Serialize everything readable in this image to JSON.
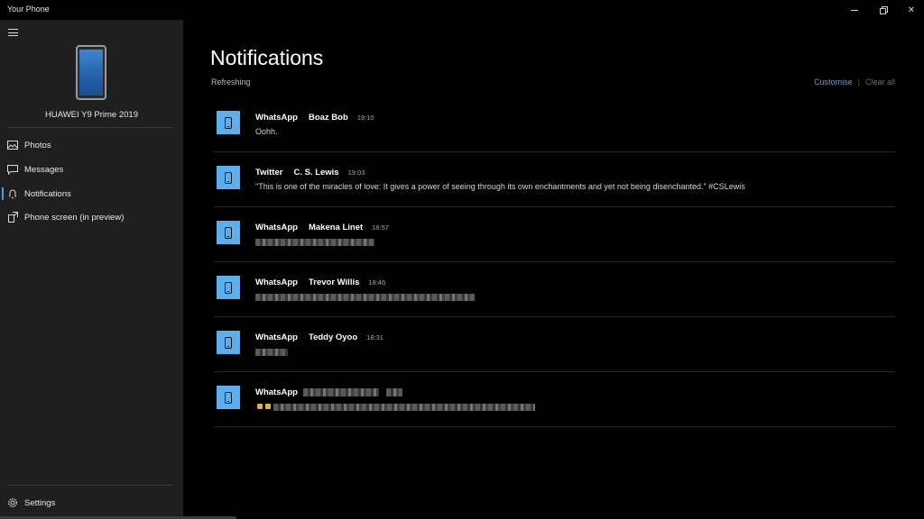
{
  "window": {
    "title": "Your Phone",
    "minimize_icon": "minimize-icon",
    "maximize_icon": "restore-icon",
    "close_icon": "close-icon",
    "close_glyph": "✕"
  },
  "sidebar": {
    "menu_icon": "hamburger-icon",
    "device_name": "HUAWEI Y9 Prime 2019",
    "items": [
      {
        "label": "Photos",
        "icon": "photos-icon"
      },
      {
        "label": "Messages",
        "icon": "message-icon"
      },
      {
        "label": "Notifications",
        "icon": "bell-icon",
        "active": true
      },
      {
        "label": "Phone screen (in preview)",
        "icon": "phone-screen-icon"
      }
    ],
    "settings": {
      "label": "Settings",
      "icon": "gear-icon"
    }
  },
  "main": {
    "title": "Notifications",
    "status": "Refreshing",
    "customise_label": "Customise",
    "separator": "|",
    "clear_all_label": "Clear all",
    "accent_color": "#4aa1ea",
    "notifications": [
      {
        "app": "WhatsApp",
        "sender": "Boaz Bob",
        "time": "19:10",
        "message": "Oohh."
      },
      {
        "app": "Twitter",
        "sender": "C. S. Lewis",
        "time": "19:03",
        "message": "\"This is one of the miracles of love: It gives a power of seeing through its own enchantments and yet not being disenchanted.\" #CSLewis"
      },
      {
        "app": "WhatsApp",
        "sender": "Makena Linet",
        "time": "18:57",
        "message": ""
      },
      {
        "app": "WhatsApp",
        "sender": "Trevor Willis",
        "time": "18:46",
        "message": ""
      },
      {
        "app": "WhatsApp",
        "sender": "Teddy Oyoo",
        "time": "18:31",
        "message": ""
      },
      {
        "app": "WhatsApp",
        "sender": "",
        "time": "",
        "message": ""
      }
    ]
  }
}
